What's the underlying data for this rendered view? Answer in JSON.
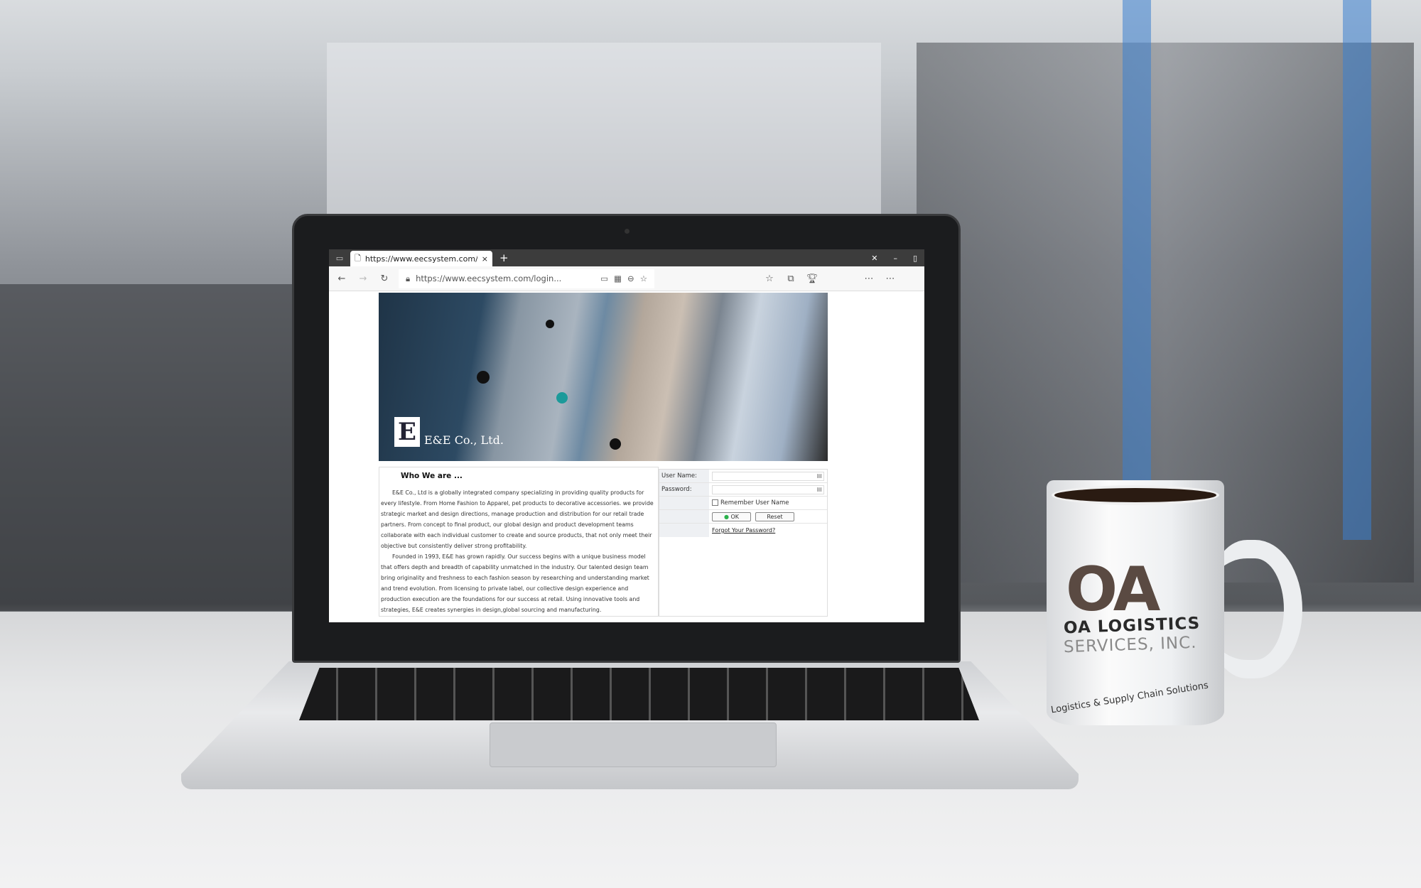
{
  "browser": {
    "tab_title": "https://www.eecsystem.com/login",
    "address": "https://www.eecsystem.com/login...",
    "new_tab": "+",
    "close_tab": "×"
  },
  "page": {
    "logo_text": "E&E Co., Ltd.",
    "about": {
      "heading": "Who We are ...",
      "p1": "E&E Co., Ltd is a globally integrated company specializing in providing quality products for every lifestyle. From Home Fashion to Apparel, pet products to decorative accessories. we provide strategic market and design directions, manage production and distribution for our retail trade partners. From concept to final product, our global design and product development teams collaborate with each individual customer to create and source products, that not only meet their objective but consistently deliver strong profitability.",
      "p2": "Founded in 1993, E&E has grown rapidly. Our success begins with a unique business model that offers depth and breadth of capability unmatched in the industry. Our talented design team bring originality and freshness to each fashion season by researching and understanding market and trend evolution. From licensing to private label, our collective design experience and production execution are the foundations for our success at retail. Using innovative tools and strategies, E&E creates synergies in design,global sourcing and manufacturing."
    },
    "login": {
      "username_label": "User Name:",
      "password_label": "Password:",
      "remember_label": "Remember User Name",
      "ok_label": "OK",
      "reset_label": "Reset",
      "forgot_label": "Forgot Your Password?"
    }
  },
  "mug": {
    "logo": "OA",
    "line1": "OA LOGISTICS",
    "line2": "SERVICES, INC.",
    "tagline": "Logistics & Supply Chain Solutions"
  }
}
